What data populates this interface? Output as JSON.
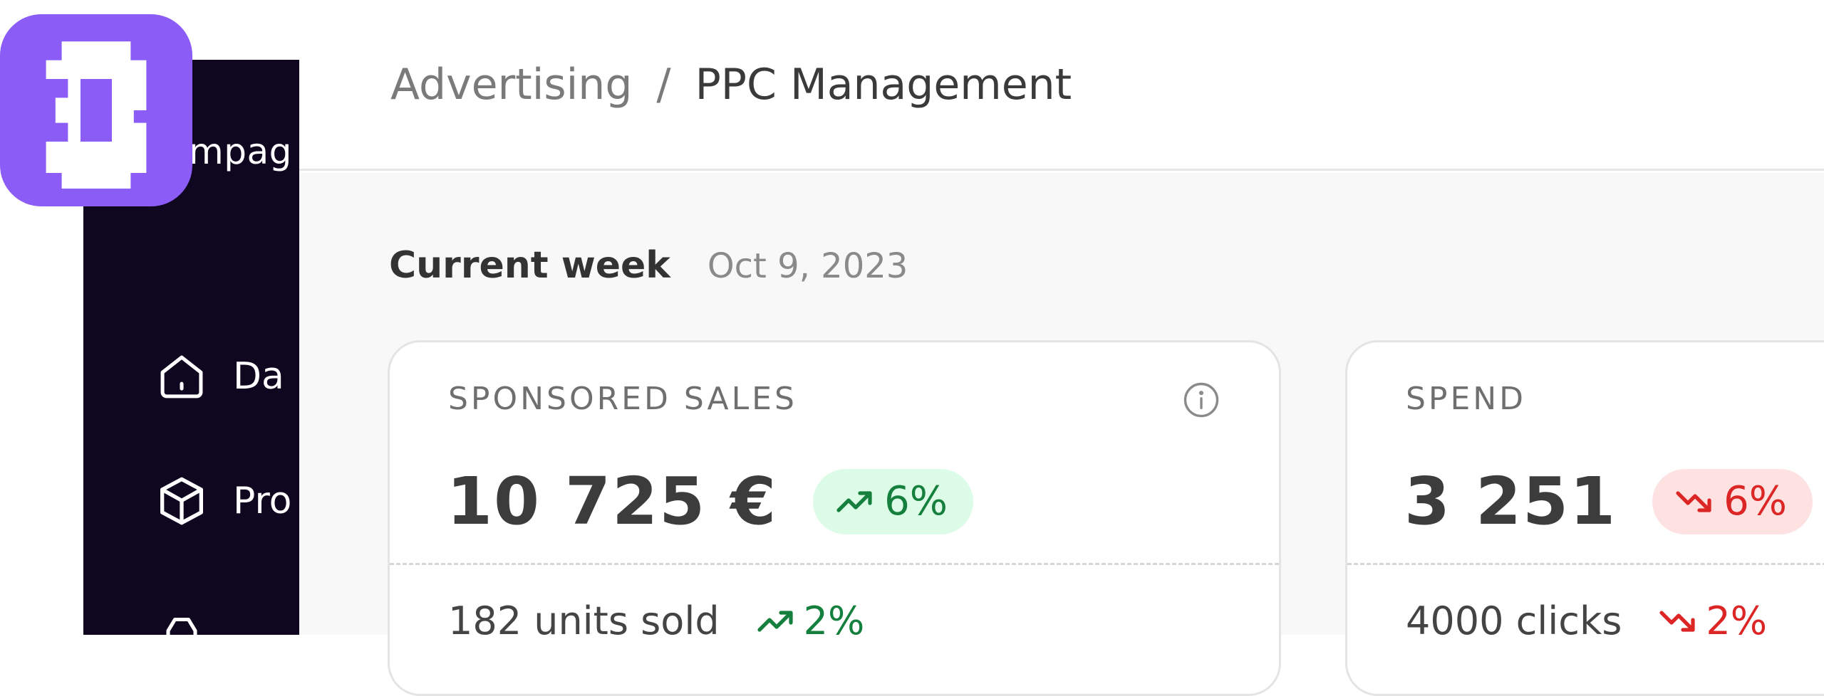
{
  "colors": {
    "sidebar_bg": "#0f0620",
    "logo_bg": "#8b5cf6",
    "trend_up": "#15803d",
    "trend_up_bg": "#dcfce7",
    "trend_down": "#dc2626",
    "trend_down_bg": "#fee2e2"
  },
  "logo": {
    "icon": "brand-logo-icon"
  },
  "sidebar": {
    "brand_partial": "mpag",
    "items": [
      {
        "label": "Da",
        "icon": "home-icon"
      },
      {
        "label": "Pro",
        "icon": "box-icon"
      },
      {
        "label": "",
        "icon": "partial-icon"
      }
    ]
  },
  "header": {
    "breadcrumb": {
      "parent": "Advertising",
      "separator": "/",
      "current": "PPC Management"
    }
  },
  "period": {
    "title": "Current week",
    "date": "Oct 9, 2023"
  },
  "cards": [
    {
      "label": "SPONSORED SALES",
      "value": "10 725 €",
      "trend": {
        "direction": "up",
        "text": "6%",
        "icon": "trending-up-icon"
      },
      "sub": {
        "text": "182 units sold",
        "trend": {
          "direction": "up",
          "text": "2%",
          "icon": "trending-up-icon"
        }
      },
      "info_icon": "info-icon"
    },
    {
      "label": "SPEND",
      "value": "3 251",
      "trend": {
        "direction": "down",
        "text": "6%",
        "icon": "trending-down-icon"
      },
      "sub": {
        "text": "4000 clicks",
        "trend": {
          "direction": "down",
          "text": "2%",
          "icon": "trending-down-icon"
        }
      }
    }
  ]
}
